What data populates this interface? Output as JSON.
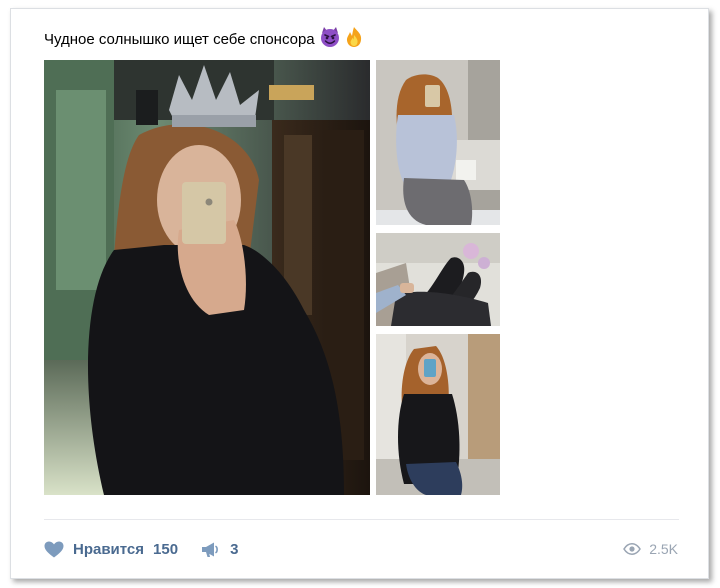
{
  "post": {
    "text": "Чудное солнышко ищет себе спонсора",
    "emojis": [
      "smiling-devil-emoji",
      "fire-emoji"
    ]
  },
  "photos": [
    {
      "name": "photo-main"
    },
    {
      "name": "photo-2"
    },
    {
      "name": "photo-3"
    },
    {
      "name": "photo-4"
    }
  ],
  "footer": {
    "like_label": "Нравится",
    "like_count": "150",
    "share_count": "3",
    "views": "2.5K"
  },
  "colors": {
    "action_text": "#4a6a90",
    "action_icon": "#7d9bbd",
    "views_text": "#9aa5b3",
    "divider": "#e7e8ec"
  }
}
